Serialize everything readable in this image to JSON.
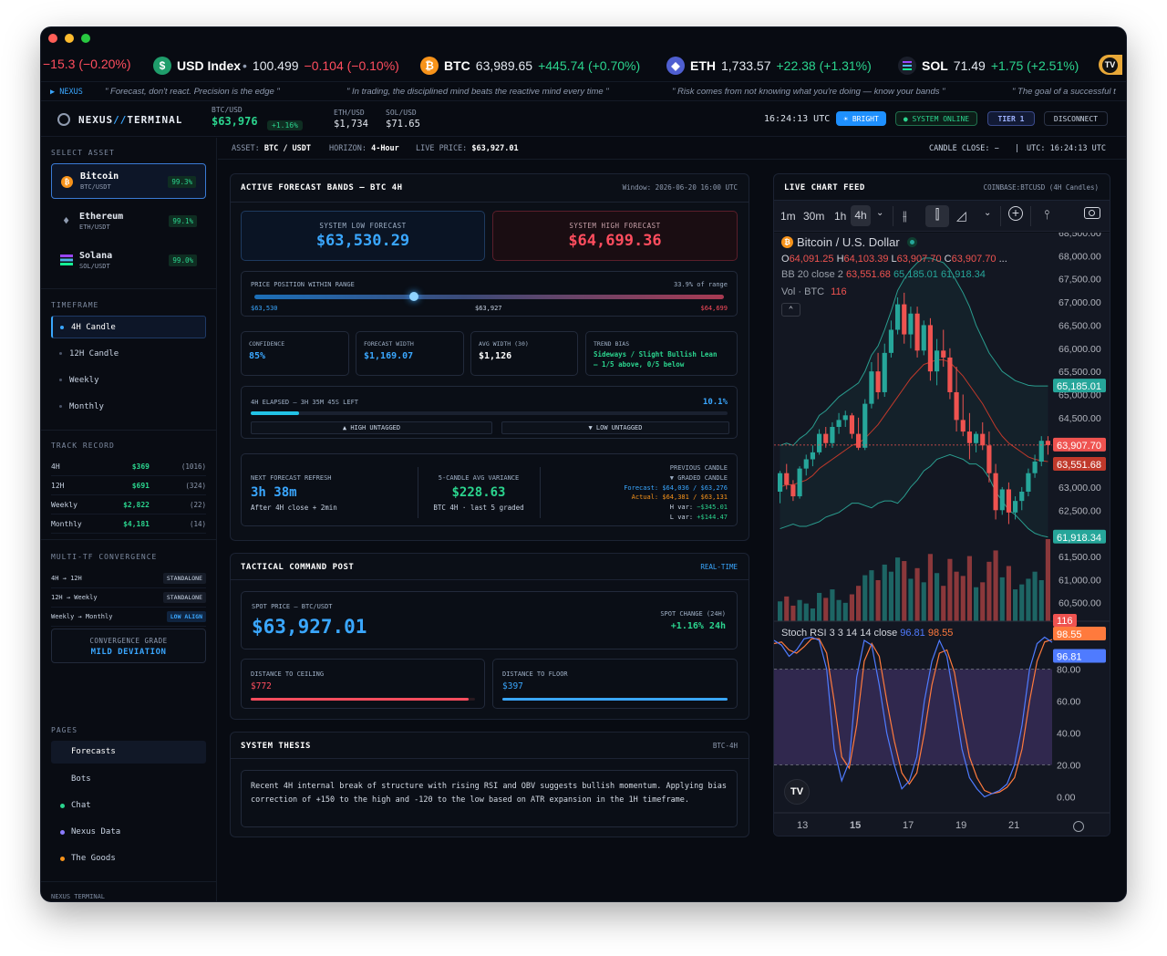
{
  "ticker": [
    {
      "value": "−15.3 (−0.20%)",
      "tone": "neg"
    },
    {
      "icon": "dollar-icon",
      "symbol": "USD Index",
      "sep": "•",
      "price": "100.499",
      "change": "−0.104 (−0.10%)",
      "tone": "neg",
      "color": "#1f9d6b"
    },
    {
      "icon": "bitcoin-icon",
      "symbol": "BTC",
      "price": "63,989.65",
      "change": "+445.74 (+0.70%)",
      "tone": "pos",
      "color": "#f7931a"
    },
    {
      "icon": "ethereum-icon",
      "symbol": "ETH",
      "price": "1,733.57",
      "change": "+22.38 (+1.31%)",
      "tone": "pos",
      "color": "#4f5fd1"
    },
    {
      "icon": "solana-icon",
      "symbol": "SOL",
      "price": "71.49",
      "change": "+1.75 (+2.51%)",
      "tone": "pos",
      "color": "#1b1f2b"
    }
  ],
  "quotes": {
    "tag": "▶ NEXUS",
    "items": [
      "\" Forecast, don't react. Precision is the edge \"",
      "\" In trading, the disciplined mind beats the reactive mind every time \"",
      "\" Risk comes from not knowing what you're doing — know your bands \"",
      "\" The goal of a successful t"
    ]
  },
  "header": {
    "brand_a": "NEXUS",
    "brand_sep": "//",
    "brand_b": "TERMINAL",
    "btc_label": "BTC/USD",
    "btc_price": "$63,976",
    "btc_change": "+1.16%",
    "eth_label": "ETH/USD",
    "eth_price": "$1,734",
    "sol_label": "SOL/USD",
    "sol_price": "$71.65",
    "clock": "16:24:13 UTC",
    "bright": "☀ BRIGHT",
    "online": "● SYSTEM ONLINE",
    "tier": "TIER 1",
    "disconnect": "DISCONNECT"
  },
  "sidebar": {
    "select_asset": "SELECT ASSET",
    "assets": [
      {
        "name": "Bitcoin",
        "pair": "BTC/USDT",
        "score": "99.3%",
        "icon": "bitcoin-icon"
      },
      {
        "name": "Ethereum",
        "pair": "ETH/USDT",
        "score": "99.1%",
        "icon": "ethereum-icon"
      },
      {
        "name": "Solana",
        "pair": "SOL/USDT",
        "score": "99.0%",
        "icon": "solana-icon"
      }
    ],
    "timeframe": "TIMEFRAME",
    "timeframes": [
      "4H Candle",
      "12H Candle",
      "Weekly",
      "Monthly"
    ],
    "track_record": "TRACK RECORD",
    "records": [
      {
        "tf": "4H",
        "amount": "$369",
        "count": "(1016)"
      },
      {
        "tf": "12H",
        "amount": "$691",
        "count": "(324)"
      },
      {
        "tf": "Weekly",
        "amount": "$2,822",
        "count": "(22)"
      },
      {
        "tf": "Monthly",
        "amount": "$4,181",
        "count": "(14)"
      }
    ],
    "convergence": "MULTI-TF CONVERGENCE",
    "conv_rows": [
      {
        "pair": "4H → 12H",
        "status": "STANDALONE"
      },
      {
        "pair": "12H → Weekly",
        "status": "STANDALONE"
      },
      {
        "pair": "Weekly → Monthly",
        "status": "LOW ALIGN"
      }
    ],
    "grade_label": "CONVERGENCE GRADE",
    "grade_value": "MILD DEVIATION",
    "pages": "PAGES",
    "page_items": [
      "Forecasts",
      "Bots",
      "Chat",
      "Nexus Data",
      "The Goods"
    ],
    "footer": "NEXUS TERMINAL"
  },
  "infobar": {
    "asset_label": "ASSET:",
    "asset": "BTC / USDT",
    "horizon_label": "HORIZON:",
    "horizon": "4-Hour",
    "live_label": "LIVE PRICE:",
    "live": "$63,927.01",
    "candle_close": "CANDLE CLOSE: −",
    "sep": "|",
    "utc": "UTC: 16:24:13 UTC"
  },
  "forecast": {
    "title": "ACTIVE FORECAST BANDS — BTC 4H",
    "window": "Window: 2026-06-20 16:00 UTC",
    "low_label": "SYSTEM LOW FORECAST",
    "low_value": "$63,530.29",
    "high_label": "SYSTEM HIGH FORECAST",
    "high_value": "$64,699.36",
    "position_label": "PRICE POSITION WITHIN RANGE",
    "position_pct": "33.9% of range",
    "position_fraction": 0.339,
    "range_low": "$63,530",
    "range_mid": "$63,927",
    "range_high": "$64,699",
    "stats": [
      {
        "label": "CONFIDENCE",
        "value": "85%"
      },
      {
        "label": "FORECAST WIDTH",
        "value": "$1,169.07"
      },
      {
        "label": "AVG WIDTH (30)",
        "value": "$1,126"
      },
      {
        "label": "TREND BIAS",
        "value": "Sideways / Slight Bullish Lean",
        "sub": "— 1/5 above, 0/5 below"
      }
    ],
    "elapsed_label": "4H ELAPSED — 3H 35M 45S LEFT",
    "elapsed_pct": "10.1%",
    "elapsed_fraction": 0.101,
    "high_untagged": "▲ HIGH UNTAGGED",
    "low_untagged": "▼ LOW UNTAGGED",
    "refresh_label": "NEXT FORECAST REFRESH",
    "refresh_value": "3h 38m",
    "refresh_sub": "After 4H close + 2min",
    "variance_label": "5-CANDLE AVG VARIANCE",
    "variance_value": "$228.63",
    "variance_sub": "BTC 4H · last 5 graded",
    "prev_label": "PREVIOUS CANDLE",
    "prev_sub": "▼ GRADED CANDLE",
    "prev_forecast": "Forecast: $64,036 / $63,276",
    "prev_actual": "Actual: $64,381 / $63,131",
    "prev_hvar_label": "H var:",
    "prev_hvar": "−$345.01",
    "prev_lvar_label": "L var:",
    "prev_lvar": "+$144.47"
  },
  "tactical": {
    "title": "TACTICAL COMMAND POST",
    "realtime": "REAL-TIME",
    "spot_label": "SPOT PRICE — BTC/USDT",
    "spot_value": "$63,927.01",
    "change_label": "SPOT CHANGE (24H)",
    "change_value": "+1.16% 24h",
    "ceiling_label": "DISTANCE TO CEILING",
    "ceiling_value": "$772",
    "floor_label": "DISTANCE TO FLOOR",
    "floor_value": "$397"
  },
  "thesis": {
    "title": "SYSTEM THESIS",
    "tag": "BTC-4H",
    "text": "Recent 4H internal break of structure with rising RSI and OBV suggests bullish momentum. Applying bias correction of +150 to the high and -120 to the low based on ATR expansion in the 1H timeframe."
  },
  "chart_panel": {
    "title": "LIVE CHART FEED",
    "source": "COINBASE:BTCUSD (4H Candles)",
    "intervals": [
      "1m",
      "30m",
      "1h",
      "4h"
    ],
    "symbol": "Bitcoin / U.S. Dollar",
    "ohlc": {
      "o_label": "O",
      "o": "64,091.25",
      "h_label": "H",
      "h": "64,103.39",
      "l_label": "L",
      "l": "63,907.70",
      "c_label": "C",
      "c": "63,907.70",
      "more": "..."
    },
    "bb_label": "BB 20 close 2",
    "bb_values": [
      "63,551.68",
      "65,185.01",
      "61,918.34"
    ],
    "vol_label": "Vol · BTC",
    "vol_value": "116",
    "stoch_label": "Stoch RSI 3 3 14 14 close",
    "stoch_k": "96.81",
    "stoch_d": "98.55",
    "price_axis": [
      "68,500.00",
      "68,000.00",
      "67,500.00",
      "67,000.00",
      "66,500.00",
      "66,000.00",
      "65,500.00",
      "65,000.00",
      "64,500.00",
      "64,000.00",
      "63,500.00",
      "63,000.00",
      "62,500.00",
      "62,000.00",
      "61,500.00",
      "61,000.00",
      "60,500.00"
    ],
    "rsi_axis": [
      "80.00",
      "60.00",
      "40.00",
      "20.00",
      "0.00"
    ],
    "dates": [
      "13",
      "15",
      "17",
      "19",
      "21"
    ],
    "tags": {
      "bb_upper": "65,185.01",
      "last": "63,907.70",
      "bb_mid": "63,551.68",
      "bb_lower": "61,918.34",
      "vol": "116",
      "stoch_d": "98.55",
      "stoch_k": "96.81"
    },
    "colors": {
      "up": "#26a69a",
      "down": "#ef5350",
      "bb": "#2a9d8f",
      "bb_mid": "#c0392b",
      "k": "#4f7bff",
      "d": "#ff7a3d"
    }
  },
  "chart_data": {
    "type": "candlestick",
    "ylim": [
      60100,
      68500
    ],
    "candles": [
      [
        62900,
        63350,
        62650,
        63300
      ],
      [
        63300,
        63500,
        62950,
        63050
      ],
      [
        63050,
        63150,
        62700,
        62800
      ],
      [
        62800,
        63450,
        62750,
        63400
      ],
      [
        63400,
        63700,
        63250,
        63600
      ],
      [
        63600,
        63900,
        63450,
        63750
      ],
      [
        63750,
        64250,
        63700,
        64150
      ],
      [
        64150,
        64300,
        63850,
        63950
      ],
      [
        63950,
        64400,
        63850,
        64300
      ],
      [
        64300,
        64600,
        64150,
        64450
      ],
      [
        64450,
        64650,
        64300,
        64550
      ],
      [
        64550,
        64600,
        64050,
        64150
      ],
      [
        64150,
        64500,
        63800,
        63850
      ],
      [
        63850,
        64900,
        63800,
        64800
      ],
      [
        64800,
        65700,
        64700,
        65500
      ],
      [
        65500,
        65900,
        64900,
        65050
      ],
      [
        65050,
        66100,
        64950,
        65900
      ],
      [
        65900,
        66600,
        65800,
        66400
      ],
      [
        66400,
        67100,
        66300,
        66950
      ],
      [
        66950,
        67200,
        66100,
        66300
      ],
      [
        66300,
        66900,
        66000,
        66750
      ],
      [
        66750,
        66900,
        65800,
        65950
      ],
      [
        65950,
        66600,
        65850,
        66500
      ],
      [
        66500,
        66650,
        65300,
        65500
      ],
      [
        65500,
        66200,
        65200,
        65950
      ],
      [
        65950,
        66400,
        65600,
        65800
      ],
      [
        65800,
        66000,
        64900,
        65050
      ],
      [
        65050,
        65600,
        64200,
        64450
      ],
      [
        64450,
        65000,
        64100,
        64200
      ],
      [
        64200,
        64600,
        63600,
        63950
      ],
      [
        63950,
        64200,
        63750,
        64150
      ],
      [
        64150,
        64400,
        63800,
        63900
      ],
      [
        63900,
        64200,
        63100,
        63300
      ],
      [
        63300,
        63500,
        62300,
        62500
      ],
      [
        62500,
        63000,
        62400,
        62950
      ],
      [
        62950,
        63100,
        62200,
        62450
      ],
      [
        62450,
        62800,
        62300,
        62700
      ],
      [
        62700,
        63000,
        62500,
        62900
      ],
      [
        62900,
        63400,
        62800,
        63300
      ],
      [
        63300,
        63700,
        63200,
        63550
      ],
      [
        63550,
        64100,
        63450,
        64000
      ],
      [
        64000,
        64100,
        63700,
        63907.7
      ]
    ],
    "bb_upper": [
      63900,
      63950,
      63900,
      64050,
      64150,
      64300,
      64550,
      64650,
      64800,
      64950,
      65050,
      65150,
      65250,
      65500,
      65850,
      66050,
      66400,
      66800,
      67250,
      67500,
      67700,
      67850,
      67950,
      67950,
      67900,
      67850,
      67700,
      67450,
      67200,
      66900,
      66500,
      66200,
      65900,
      65700,
      65500,
      65400,
      65300,
      65250,
      65200,
      65185,
      65185,
      65185
    ],
    "bb_mid": [
      63000,
      63050,
      63050,
      63100,
      63150,
      63250,
      63400,
      63500,
      63600,
      63700,
      63800,
      63900,
      63950,
      64050,
      64200,
      64350,
      64550,
      64750,
      64950,
      65150,
      65350,
      65500,
      65650,
      65700,
      65750,
      65750,
      65700,
      65550,
      65400,
      65200,
      65000,
      64800,
      64550,
      64300,
      64100,
      63950,
      63850,
      63750,
      63650,
      63600,
      63570,
      63551.68
    ],
    "bb_lower": [
      62100,
      62150,
      62200,
      62150,
      62150,
      62200,
      62250,
      62350,
      62400,
      62450,
      62550,
      62650,
      62650,
      62600,
      62550,
      62650,
      62700,
      62700,
      62650,
      62800,
      63000,
      63150,
      63350,
      63450,
      63600,
      63650,
      63700,
      63650,
      63600,
      63500,
      63500,
      63400,
      63200,
      62900,
      62700,
      62500,
      62400,
      62250,
      62100,
      62000,
      61950,
      61918.34
    ],
    "volume": [
      28,
      35,
      22,
      30,
      25,
      18,
      40,
      33,
      45,
      30,
      26,
      38,
      50,
      65,
      72,
      58,
      80,
      70,
      90,
      85,
      60,
      75,
      55,
      95,
      68,
      50,
      88,
      70,
      64,
      92,
      48,
      55,
      84,
      100,
      62,
      78,
      45,
      52,
      60,
      70,
      58,
      116
    ],
    "stoch_k": [
      98,
      95,
      88,
      92,
      99,
      100,
      98,
      80,
      30,
      10,
      22,
      75,
      98,
      95,
      70,
      40,
      20,
      5,
      10,
      25,
      60,
      85,
      98,
      88,
      60,
      30,
      12,
      5,
      0,
      2,
      4,
      8,
      20,
      45,
      80,
      96,
      100,
      96.81
    ],
    "stoch_d": [
      96,
      97,
      92,
      90,
      94,
      99,
      99,
      90,
      60,
      25,
      18,
      45,
      85,
      96,
      88,
      60,
      35,
      15,
      8,
      15,
      40,
      70,
      90,
      92,
      78,
      50,
      25,
      12,
      4,
      2,
      3,
      6,
      12,
      30,
      60,
      85,
      97,
      98.55
    ],
    "stoch_ylim": [
      -10,
      110
    ]
  }
}
